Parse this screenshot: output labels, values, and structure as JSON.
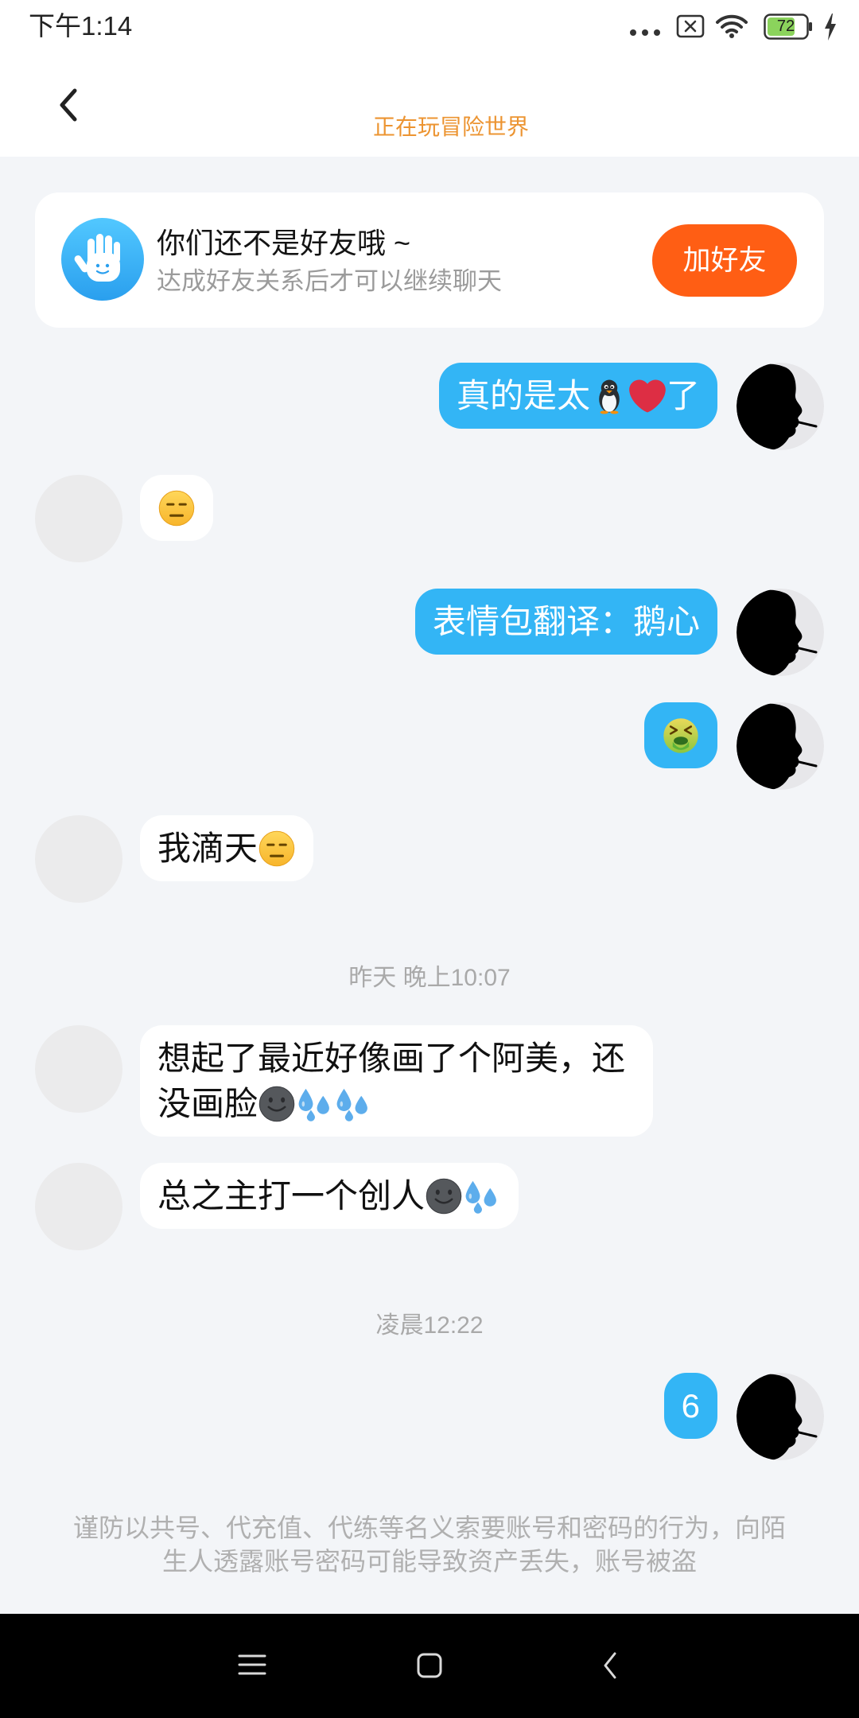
{
  "status_bar": {
    "time": "下午1:14",
    "battery_level": "72",
    "icons": [
      "more-dots-icon",
      "no-sim-icon",
      "wifi-icon",
      "battery-icon",
      "charging-bolt-icon"
    ]
  },
  "header": {
    "back_icon": "chevron-left-icon",
    "status": "正在玩冒险世界"
  },
  "friend_notice": {
    "icon": "waving-hand-icon",
    "title": "你们还不是好友哦 ~",
    "subtitle": "达成好友关系后才可以继续聊天",
    "button_label": "加好友"
  },
  "chat": [
    {
      "outgoing": true,
      "parts": [
        {
          "text": "真的是太"
        },
        {
          "emoji": "penguin-emoji"
        },
        {
          "emoji": "red-heart-emoji"
        },
        {
          "text": "了"
        }
      ]
    },
    {
      "outgoing": false,
      "parts": [
        {
          "emoji": "expressionless-face-emoji"
        }
      ]
    },
    {
      "outgoing": true,
      "parts": [
        {
          "text": "表情包翻译：鹅心"
        }
      ]
    },
    {
      "outgoing": true,
      "parts": [
        {
          "emoji": "face-vomiting-emoji"
        }
      ]
    },
    {
      "outgoing": false,
      "parts": [
        {
          "text": "我滴天"
        },
        {
          "emoji": "expressionless-face-emoji"
        }
      ]
    },
    {
      "timestamp": "昨天 晚上10:07"
    },
    {
      "outgoing": false,
      "parts": [
        {
          "text": "想起了最近好像画了个阿美，还没画脸"
        },
        {
          "emoji": "new-moon-face-emoji"
        },
        {
          "emoji": "sweat-droplets-emoji"
        },
        {
          "emoji": "sweat-droplets-emoji"
        }
      ]
    },
    {
      "outgoing": false,
      "parts": [
        {
          "text": "总之主打一个创人"
        },
        {
          "emoji": "new-moon-face-emoji"
        },
        {
          "emoji": "sweat-droplets-emoji"
        }
      ]
    },
    {
      "timestamp": "凌晨12:22"
    },
    {
      "outgoing": true,
      "parts": [
        {
          "text": "6"
        }
      ]
    }
  ],
  "safety_notice": "谨防以共号、代充值、代练等名义索要账号和密码的行为，向陌生人透露账号密码可能导致资产丢失，账号被盗",
  "nav_bar": {
    "icons": [
      "menu-icon",
      "home-icon",
      "back-icon"
    ]
  },
  "colors": {
    "accent_blue": "#33B5F5",
    "button_orange": "#FF5E14",
    "subtitle_orange": "#EC9431",
    "background": "#F3F5F8",
    "battery_green": "#8BD35C"
  }
}
